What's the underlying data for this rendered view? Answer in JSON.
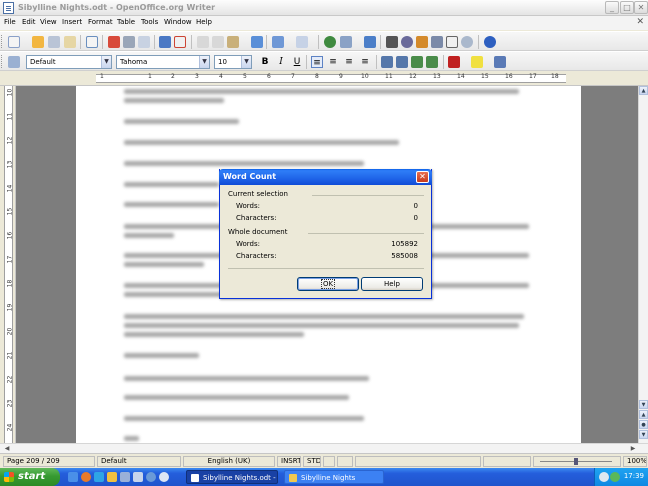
{
  "window": {
    "title": "Sibylline Nights.odt - OpenOffice.org Writer",
    "minimize": "_",
    "maximize": "□",
    "close": "✕"
  },
  "menubar": {
    "items": [
      "File",
      "Edit",
      "View",
      "Insert",
      "Format",
      "Table",
      "Tools",
      "Window",
      "Help"
    ],
    "close_doc": "✕"
  },
  "toolbar_standard": {
    "icons": [
      "new-icon",
      "open-icon",
      "save-icon",
      "email-icon",
      "edit-file-icon",
      "export-pdf-icon",
      "print-icon",
      "page-preview-icon",
      "spellcheck-icon",
      "autospellcheck-icon",
      "cut-icon",
      "copy-icon",
      "paste-icon",
      "clone-formatting-icon",
      "undo-icon",
      "redo-icon",
      "hyperlink-icon",
      "table-icon",
      "show-draw-functions-icon",
      "find-replace-icon",
      "navigator-icon",
      "gallery-icon",
      "data-sources-icon",
      "nonprinting-characters-icon",
      "zoom-icon",
      "help-icon"
    ]
  },
  "toolbar_formatting": {
    "style": "Default",
    "font": "Tahoma",
    "size": "10",
    "bold": "B",
    "italic": "I",
    "underline": "U"
  },
  "ruler": {
    "numbers": [
      "1",
      "1",
      "2",
      "3",
      "4",
      "5",
      "6",
      "7",
      "8",
      "9",
      "10",
      "11",
      "12",
      "13",
      "14",
      "15",
      "16",
      "17",
      "18"
    ]
  },
  "vruler": {
    "numbers": [
      "10",
      "11",
      "12",
      "13",
      "14",
      "15",
      "16",
      "17",
      "18",
      "19",
      "20",
      "21",
      "22",
      "23",
      "24"
    ]
  },
  "dialog": {
    "title": "Word Count",
    "current_selection": "Current selection",
    "whole_document": "Whole document",
    "words_label": "Words:",
    "characters_label": "Characters:",
    "selection_words": "0",
    "selection_characters": "0",
    "document_words": "105892",
    "document_characters": "585008",
    "ok": "OK",
    "help": "Help"
  },
  "statusbar": {
    "page": "Page 209 / 209",
    "style": "Default",
    "language": "English (UK)",
    "insert_mode": "INSRT",
    "selection_mode": "STD",
    "zoom": "100%"
  },
  "taskbar": {
    "start": "start",
    "tasks": [
      "Sibylline Nights.odt - ...",
      "Sibylline Nights"
    ],
    "clock": "17:39"
  }
}
